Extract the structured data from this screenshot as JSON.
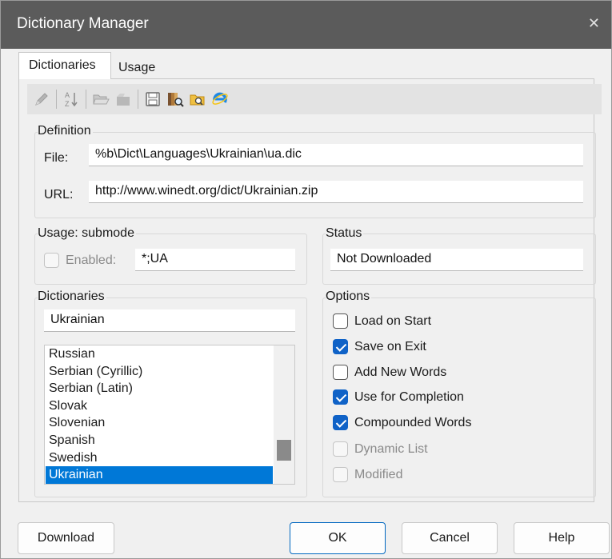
{
  "window": {
    "title": "Dictionary Manager",
    "close_glyph": "✕"
  },
  "tabs": [
    {
      "label": "Dictionaries",
      "active": true
    },
    {
      "label": "Usage",
      "active": false
    }
  ],
  "toolbar": {
    "icons": [
      "pencil-icon",
      "sort-az-icon",
      "open-folder-icon",
      "open-icon",
      "save-icon",
      "find-dictionary-icon",
      "browse-folder-icon",
      "internet-explorer-icon"
    ]
  },
  "definition": {
    "title": "Definition",
    "file_label": "File:",
    "file_value": "%b\\Dict\\Languages\\Ukrainian\\ua.dic",
    "url_label": "URL:",
    "url_value": "http://www.winedt.org/dict/Ukrainian.zip"
  },
  "usage": {
    "title": "Usage: submode",
    "enabled_label": "Enabled:",
    "enabled_checked": false,
    "submode_value": "*;UA"
  },
  "status": {
    "title": "Status",
    "value": "Not Downloaded"
  },
  "dictionaries": {
    "title": "Dictionaries",
    "current": "Ukrainian",
    "items": [
      "Russian",
      "Serbian (Cyrillic)",
      "Serbian (Latin)",
      "Slovak",
      "Slovenian",
      "Spanish",
      "Swedish",
      "Ukrainian"
    ],
    "selected": "Ukrainian"
  },
  "options": {
    "title": "Options",
    "items": [
      {
        "label": "Load on Start",
        "checked": false,
        "enabled": true
      },
      {
        "label": "Save on Exit",
        "checked": true,
        "enabled": true
      },
      {
        "label": "Add New Words",
        "checked": false,
        "enabled": true
      },
      {
        "label": "Use for Completion",
        "checked": true,
        "enabled": true
      },
      {
        "label": "Compounded Words",
        "checked": true,
        "enabled": true
      },
      {
        "label": "Dynamic List",
        "checked": false,
        "enabled": false
      },
      {
        "label": "Modified",
        "checked": false,
        "enabled": false
      }
    ]
  },
  "buttons": {
    "download": "Download",
    "ok": "OK",
    "cancel": "Cancel",
    "help": "Help"
  },
  "colors": {
    "titlebar": "#5b5b5b",
    "accent": "#0078d7",
    "checkbox_checked": "#0f62c7"
  }
}
